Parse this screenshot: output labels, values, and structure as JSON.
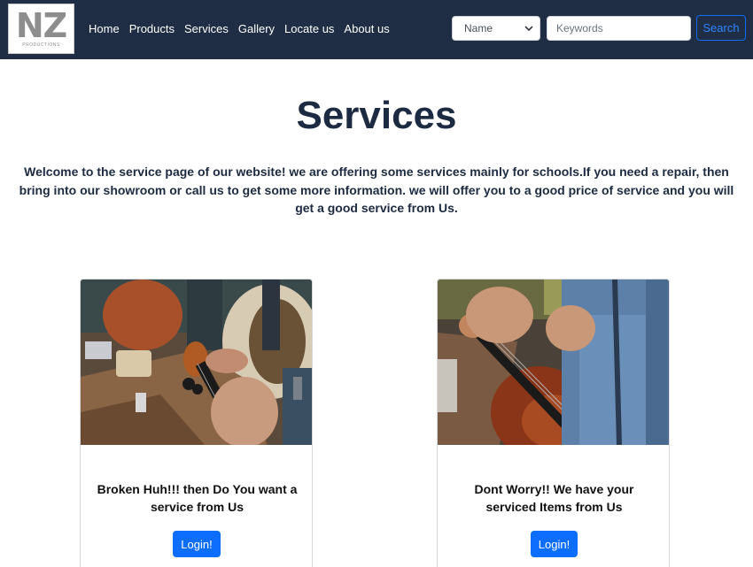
{
  "navbar": {
    "logo": {
      "mark": "NZ",
      "sub": "PRODUCTIONS"
    },
    "links": [
      "Home",
      "Products",
      "Services",
      "Gallery",
      "Locate us",
      "About us"
    ],
    "search": {
      "select_value": "Name",
      "input_placeholder": "Keywords",
      "button_label": "Search"
    }
  },
  "main": {
    "title": "Services",
    "intro": "Welcome to the service page of our website! we are offering some services mainly for schools.If you need a repair, then bring into our showroom or call us to get some more information. we will offer you to a good price of service and you will get a good service from Us."
  },
  "cards": [
    {
      "text": "Broken Huh!!! then Do You want a service from Us",
      "button": "Login!"
    },
    {
      "text": "Dont Worry!! We have your serviced Items from Us",
      "button": "Login!"
    }
  ],
  "colors": {
    "navbar_bg": "#1f2d45",
    "title_text": "#1c2b42",
    "primary": "#0d6efd"
  }
}
